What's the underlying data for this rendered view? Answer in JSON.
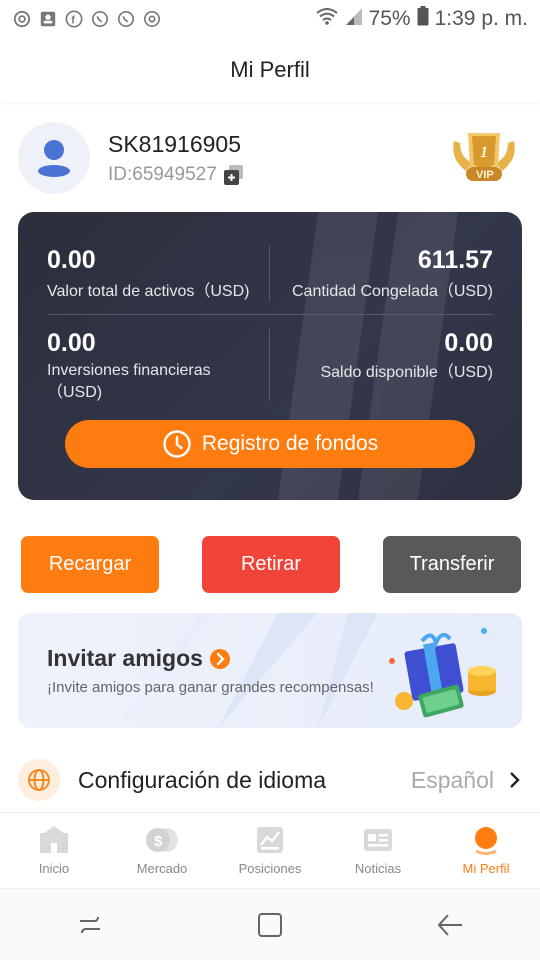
{
  "status_bar": {
    "battery": "75%",
    "time": "1:39 p. m.",
    "left_icons": [
      "chrome-icon",
      "contact-card-icon",
      "facebook-icon",
      "whatsapp-icon",
      "whatsapp-icon",
      "camera-icon"
    ]
  },
  "header": {
    "title": "Mi Perfil"
  },
  "profile": {
    "username": "SK81916905",
    "id_text": "ID:65949527",
    "vip_badge_text": "VIP",
    "vip_level": "1"
  },
  "assets": {
    "total_value": "0.00",
    "total_label": "Valor total de activos（USD)",
    "frozen_value": "611.57",
    "frozen_label": "Cantidad Congelada（USD)",
    "investments_value": "0.00",
    "investments_label_line1": "Inversiones financieras",
    "investments_label_line2": "（USD)",
    "available_value": "0.00",
    "available_label": "Saldo disponible（USD)",
    "fund_record_button": "Registro de fondos"
  },
  "actions": {
    "recharge": "Recargar",
    "withdraw": "Retirar",
    "transfer": "Transferir"
  },
  "invite": {
    "title": "Invitar amigos",
    "subtitle": "¡Invite amigos para ganar grandes recompensas!"
  },
  "language_setting": {
    "label": "Configuración de idioma",
    "value": "Español"
  },
  "bottom_nav": {
    "items": [
      {
        "label": "Inicio"
      },
      {
        "label": "Mercado"
      },
      {
        "label": "Posiciones"
      },
      {
        "label": "Noticias"
      },
      {
        "label": "Mi Perfil"
      }
    ],
    "active": "Mi Perfil"
  },
  "colors": {
    "accent_orange": "#ff7c10",
    "withdraw_red": "#f04438",
    "transfer_gray": "#595959",
    "card_dark": "#2f3242"
  }
}
